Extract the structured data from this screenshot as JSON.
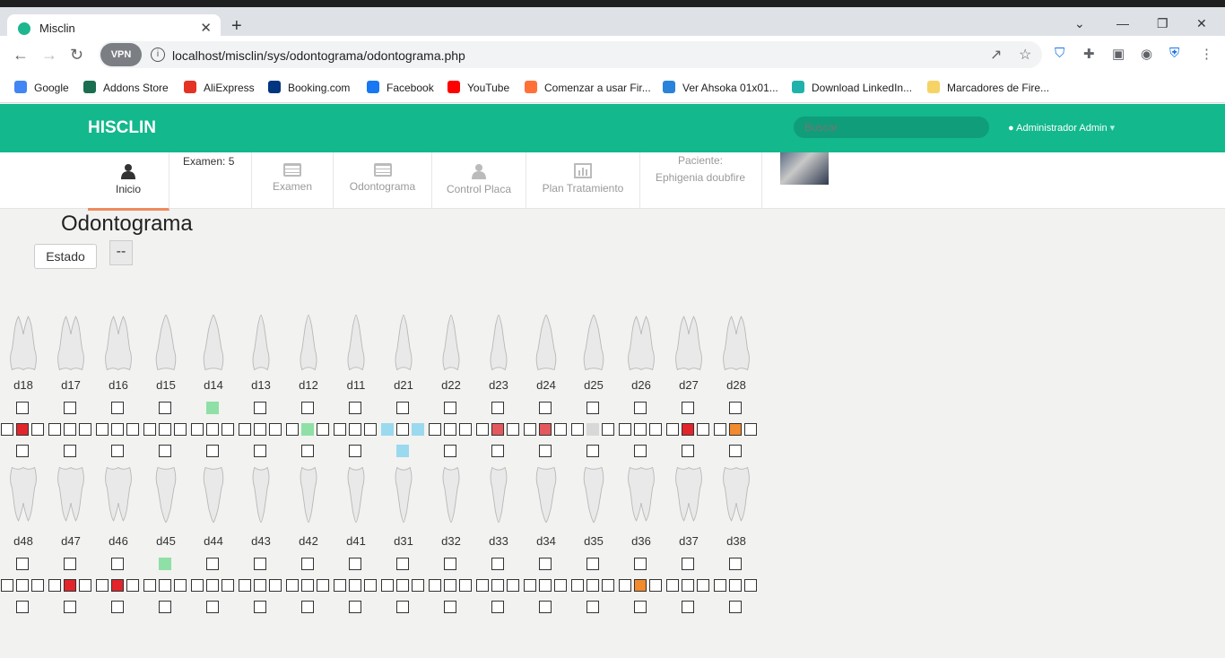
{
  "browser": {
    "tab_title": "Misclin",
    "url": "localhost/misclin/sys/odontograma/odontograma.php",
    "vpn_label": "VPN",
    "bookmarks": [
      {
        "label": "Google",
        "color": "#4285f4"
      },
      {
        "label": "Addons Store",
        "color": "#1b6e4f"
      },
      {
        "label": "AliExpress",
        "color": "#e43225"
      },
      {
        "label": "Booking.com",
        "color": "#003580"
      },
      {
        "label": "Facebook",
        "color": "#1877f2"
      },
      {
        "label": "YouTube",
        "color": "#ff0000"
      },
      {
        "label": "Comenzar a usar Fir...",
        "color": "#ff7139"
      },
      {
        "label": "Ver Ahsoka 01x01...",
        "color": "#2a82da"
      },
      {
        "label": "Download LinkedIn...",
        "color": "#20b2aa"
      },
      {
        "label": "Marcadores de Fire...",
        "color": "#f6d365"
      }
    ]
  },
  "app": {
    "brand": "HISCLIN",
    "search_placeholder": "Buscar",
    "user": "Administrador Admin",
    "accent": "#13b88d"
  },
  "menu": {
    "inicio": "Inicio",
    "examen_info": "Examen: 5",
    "examen": "Examen",
    "odontograma": "Odontograma",
    "control_placa": "Control Placa",
    "plan_tratamiento": "Plan Tratamiento",
    "paciente_label": "Paciente:",
    "paciente_name": "Ephigenia doubfire"
  },
  "content": {
    "title": "Odontograma",
    "estado_button": "Estado",
    "selector_value": "--"
  },
  "upper_teeth": [
    {
      "label": "d18",
      "cells": {
        "top": "",
        "left": "",
        "center": "red",
        "right": "",
        "bottom": ""
      }
    },
    {
      "label": "d17",
      "cells": {
        "top": "",
        "left": "",
        "center": "",
        "right": "",
        "bottom": ""
      }
    },
    {
      "label": "d16",
      "cells": {
        "top": "",
        "left": "",
        "center": "",
        "right": "",
        "bottom": ""
      }
    },
    {
      "label": "d15",
      "cells": {
        "top": "",
        "left": "",
        "center": "",
        "right": "",
        "bottom": ""
      }
    },
    {
      "label": "d14",
      "cells": {
        "top": "green",
        "left": "",
        "center": "",
        "right": "",
        "bottom": ""
      }
    },
    {
      "label": "d13",
      "cells": {
        "top": "",
        "left": "",
        "center": "",
        "right": "",
        "bottom": ""
      }
    },
    {
      "label": "d12",
      "cells": {
        "top": "",
        "left": "",
        "center": "green",
        "right": "",
        "bottom": ""
      }
    },
    {
      "label": "d11",
      "cells": {
        "top": "",
        "left": "",
        "center": "",
        "right": "",
        "bottom": ""
      }
    },
    {
      "label": "d21",
      "cells": {
        "top": "",
        "left": "blue",
        "center": "",
        "right": "blue",
        "bottom": "blue"
      }
    },
    {
      "label": "d22",
      "cells": {
        "top": "",
        "left": "",
        "center": "",
        "right": "",
        "bottom": ""
      }
    },
    {
      "label": "d23",
      "cells": {
        "top": "",
        "left": "",
        "center": "salmon",
        "right": "",
        "bottom": ""
      }
    },
    {
      "label": "d24",
      "cells": {
        "top": "",
        "left": "",
        "center": "salmon",
        "right": "",
        "bottom": ""
      }
    },
    {
      "label": "d25",
      "cells": {
        "top": "",
        "left": "",
        "center": "gray",
        "right": "",
        "bottom": ""
      }
    },
    {
      "label": "d26",
      "cells": {
        "top": "",
        "left": "",
        "center": "",
        "right": "",
        "bottom": ""
      }
    },
    {
      "label": "d27",
      "cells": {
        "top": "",
        "left": "",
        "center": "red",
        "right": "",
        "bottom": ""
      }
    },
    {
      "label": "d28",
      "cells": {
        "top": "",
        "left": "",
        "center": "orange",
        "right": "",
        "bottom": ""
      }
    }
  ],
  "lower_teeth": [
    {
      "label": "d48",
      "cells": {
        "top": "",
        "left": "",
        "center": "",
        "right": "",
        "bottom": ""
      }
    },
    {
      "label": "d47",
      "cells": {
        "top": "",
        "left": "",
        "center": "red",
        "right": "",
        "bottom": ""
      }
    },
    {
      "label": "d46",
      "cells": {
        "top": "",
        "left": "",
        "center": "red",
        "right": "",
        "bottom": ""
      }
    },
    {
      "label": "d45",
      "cells": {
        "top": "green",
        "left": "",
        "center": "",
        "right": "",
        "bottom": ""
      }
    },
    {
      "label": "d44",
      "cells": {
        "top": "",
        "left": "",
        "center": "",
        "right": "",
        "bottom": ""
      }
    },
    {
      "label": "d43",
      "cells": {
        "top": "",
        "left": "",
        "center": "",
        "right": "",
        "bottom": ""
      }
    },
    {
      "label": "d42",
      "cells": {
        "top": "",
        "left": "",
        "center": "",
        "right": "",
        "bottom": ""
      }
    },
    {
      "label": "d41",
      "cells": {
        "top": "",
        "left": "",
        "center": "",
        "right": "",
        "bottom": ""
      }
    },
    {
      "label": "d31",
      "cells": {
        "top": "",
        "left": "",
        "center": "",
        "right": "",
        "bottom": ""
      }
    },
    {
      "label": "d32",
      "cells": {
        "top": "",
        "left": "",
        "center": "",
        "right": "",
        "bottom": ""
      }
    },
    {
      "label": "d33",
      "cells": {
        "top": "",
        "left": "",
        "center": "",
        "right": "",
        "bottom": ""
      }
    },
    {
      "label": "d34",
      "cells": {
        "top": "",
        "left": "",
        "center": "",
        "right": "",
        "bottom": ""
      }
    },
    {
      "label": "d35",
      "cells": {
        "top": "",
        "left": "",
        "center": "",
        "right": "",
        "bottom": ""
      }
    },
    {
      "label": "d36",
      "cells": {
        "top": "",
        "left": "",
        "center": "orange",
        "right": "",
        "bottom": ""
      }
    },
    {
      "label": "d37",
      "cells": {
        "top": "",
        "left": "",
        "center": "",
        "right": "",
        "bottom": ""
      }
    },
    {
      "label": "d38",
      "cells": {
        "top": "",
        "left": "",
        "center": "",
        "right": "",
        "bottom": ""
      }
    }
  ]
}
